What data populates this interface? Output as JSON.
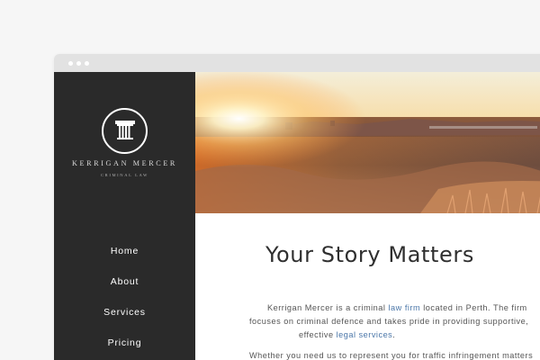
{
  "site": {
    "brand_name": "KERRIGAN MERCER",
    "brand_tagline": "CRIMINAL LAW",
    "logo_icon": "column-icon"
  },
  "nav": {
    "items": [
      "Home",
      "About",
      "Services",
      "Pricing"
    ]
  },
  "hero": {
    "image": "sunset-cityscape"
  },
  "main": {
    "headline": "Your Story Matters",
    "intro_line1_a": "Kerrigan Mercer is a criminal ",
    "intro_link1": "law firm",
    "intro_line1_b": " located in Perth.  The firm",
    "intro_line2": "focuses on criminal defence and takes pride in providing supportive,",
    "intro_line3_a": "effective ",
    "intro_link2": "legal services",
    "intro_line3_b": ".",
    "second_para": "Whether you need us to represent you for traffic infringement matters"
  },
  "colors": {
    "sidebar": "#2a2a2a",
    "link": "#4a76a8",
    "browser_bar": "#e2e2e2"
  }
}
